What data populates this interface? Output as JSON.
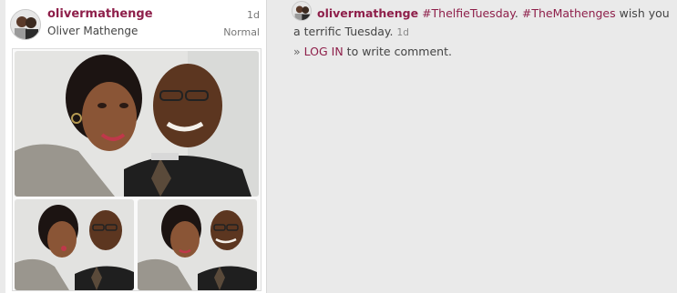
{
  "post": {
    "username": "olivermathenge",
    "full_name": "Oliver Mathenge",
    "time_ago": "1d",
    "filter": "Normal",
    "photo_description_icons": [
      "couple-selfie-photo",
      "couple-pose-photo",
      "couple-pose-photo"
    ]
  },
  "comments": {
    "caption_user": "olivermathenge",
    "hashtag_1": "#ThelfieTuesday",
    "separator": ".",
    "hashtag_2": "#TheMathenges",
    "caption_text": " wish you a terrific Tuesday.",
    "caption_time": "1d",
    "login_prefix": "»",
    "login_link": "LOG IN",
    "login_suffix": " to write comment."
  },
  "colors": {
    "accent": "#8e1f4a",
    "background": "#eaeaea",
    "card": "#ffffff"
  }
}
